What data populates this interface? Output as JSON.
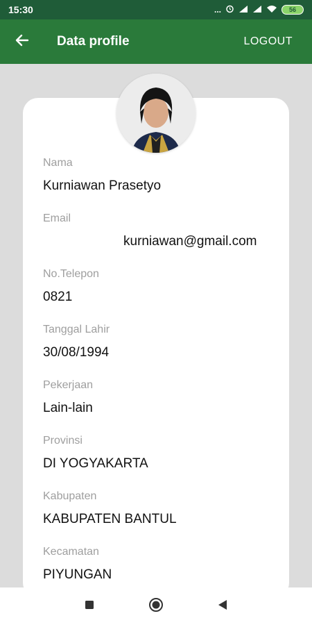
{
  "status_bar": {
    "time": "15:30",
    "overflow_dots": "...",
    "battery": "56"
  },
  "app_bar": {
    "title": "Data profile",
    "logout_label": "LOGOUT"
  },
  "profile": {
    "fields": [
      {
        "label": "Nama",
        "value": "Kurniawan Prasetyo"
      },
      {
        "label": "Email",
        "value": "kurniawan@gmail.com"
      },
      {
        "label": "No.Telepon",
        "value": "0821"
      },
      {
        "label": "Tanggal Lahir",
        "value": "30/08/1994"
      },
      {
        "label": "Pekerjaan",
        "value": "Lain-lain"
      },
      {
        "label": "Provinsi",
        "value": "DI YOGYAKARTA"
      },
      {
        "label": "Kabupaten",
        "value": "KABUPATEN BANTUL"
      },
      {
        "label": "Kecamatan",
        "value": "PIYUNGAN"
      }
    ]
  },
  "colors": {
    "status_bar": "#1f5c38",
    "app_bar": "#2a7a3a",
    "background": "#dcdcdc",
    "card": "#ffffff",
    "label": "#9e9e9e"
  },
  "icons": [
    "back-arrow-icon",
    "alarm-icon",
    "signal-icon",
    "wifi-icon",
    "battery-icon",
    "recent-apps-icon",
    "home-icon",
    "back-nav-icon"
  ]
}
